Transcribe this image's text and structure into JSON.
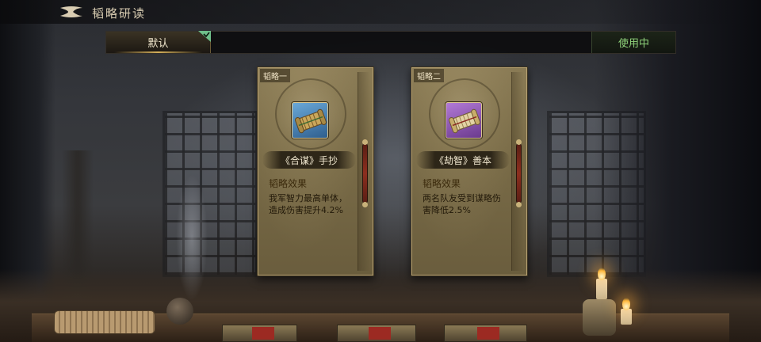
{
  "header": {
    "title": "韬略研读"
  },
  "scheme_bar": {
    "selected_tab": "默认",
    "status_button": "使用中"
  },
  "cards": [
    {
      "slot": "韬略一",
      "name": "《合谋》手抄",
      "effect_title": "韬略效果",
      "effect_desc": "我军智力最高单体，造成伤害提升4.2%",
      "icon": "bamboo-scroll-icon",
      "icon_bg": "#4a86bd"
    },
    {
      "slot": "韬略二",
      "name": "《劫智》善本",
      "effect_title": "韬略效果",
      "effect_desc": "两名队友受到谋略伤害降低2.5%",
      "icon": "bamboo-scroll-icon",
      "icon_bg": "#8d55b4"
    }
  ],
  "colors": {
    "in_use_green": "#8fd27a",
    "card_parchment": "#7a6c48",
    "gold_accent": "#d4af5a"
  }
}
